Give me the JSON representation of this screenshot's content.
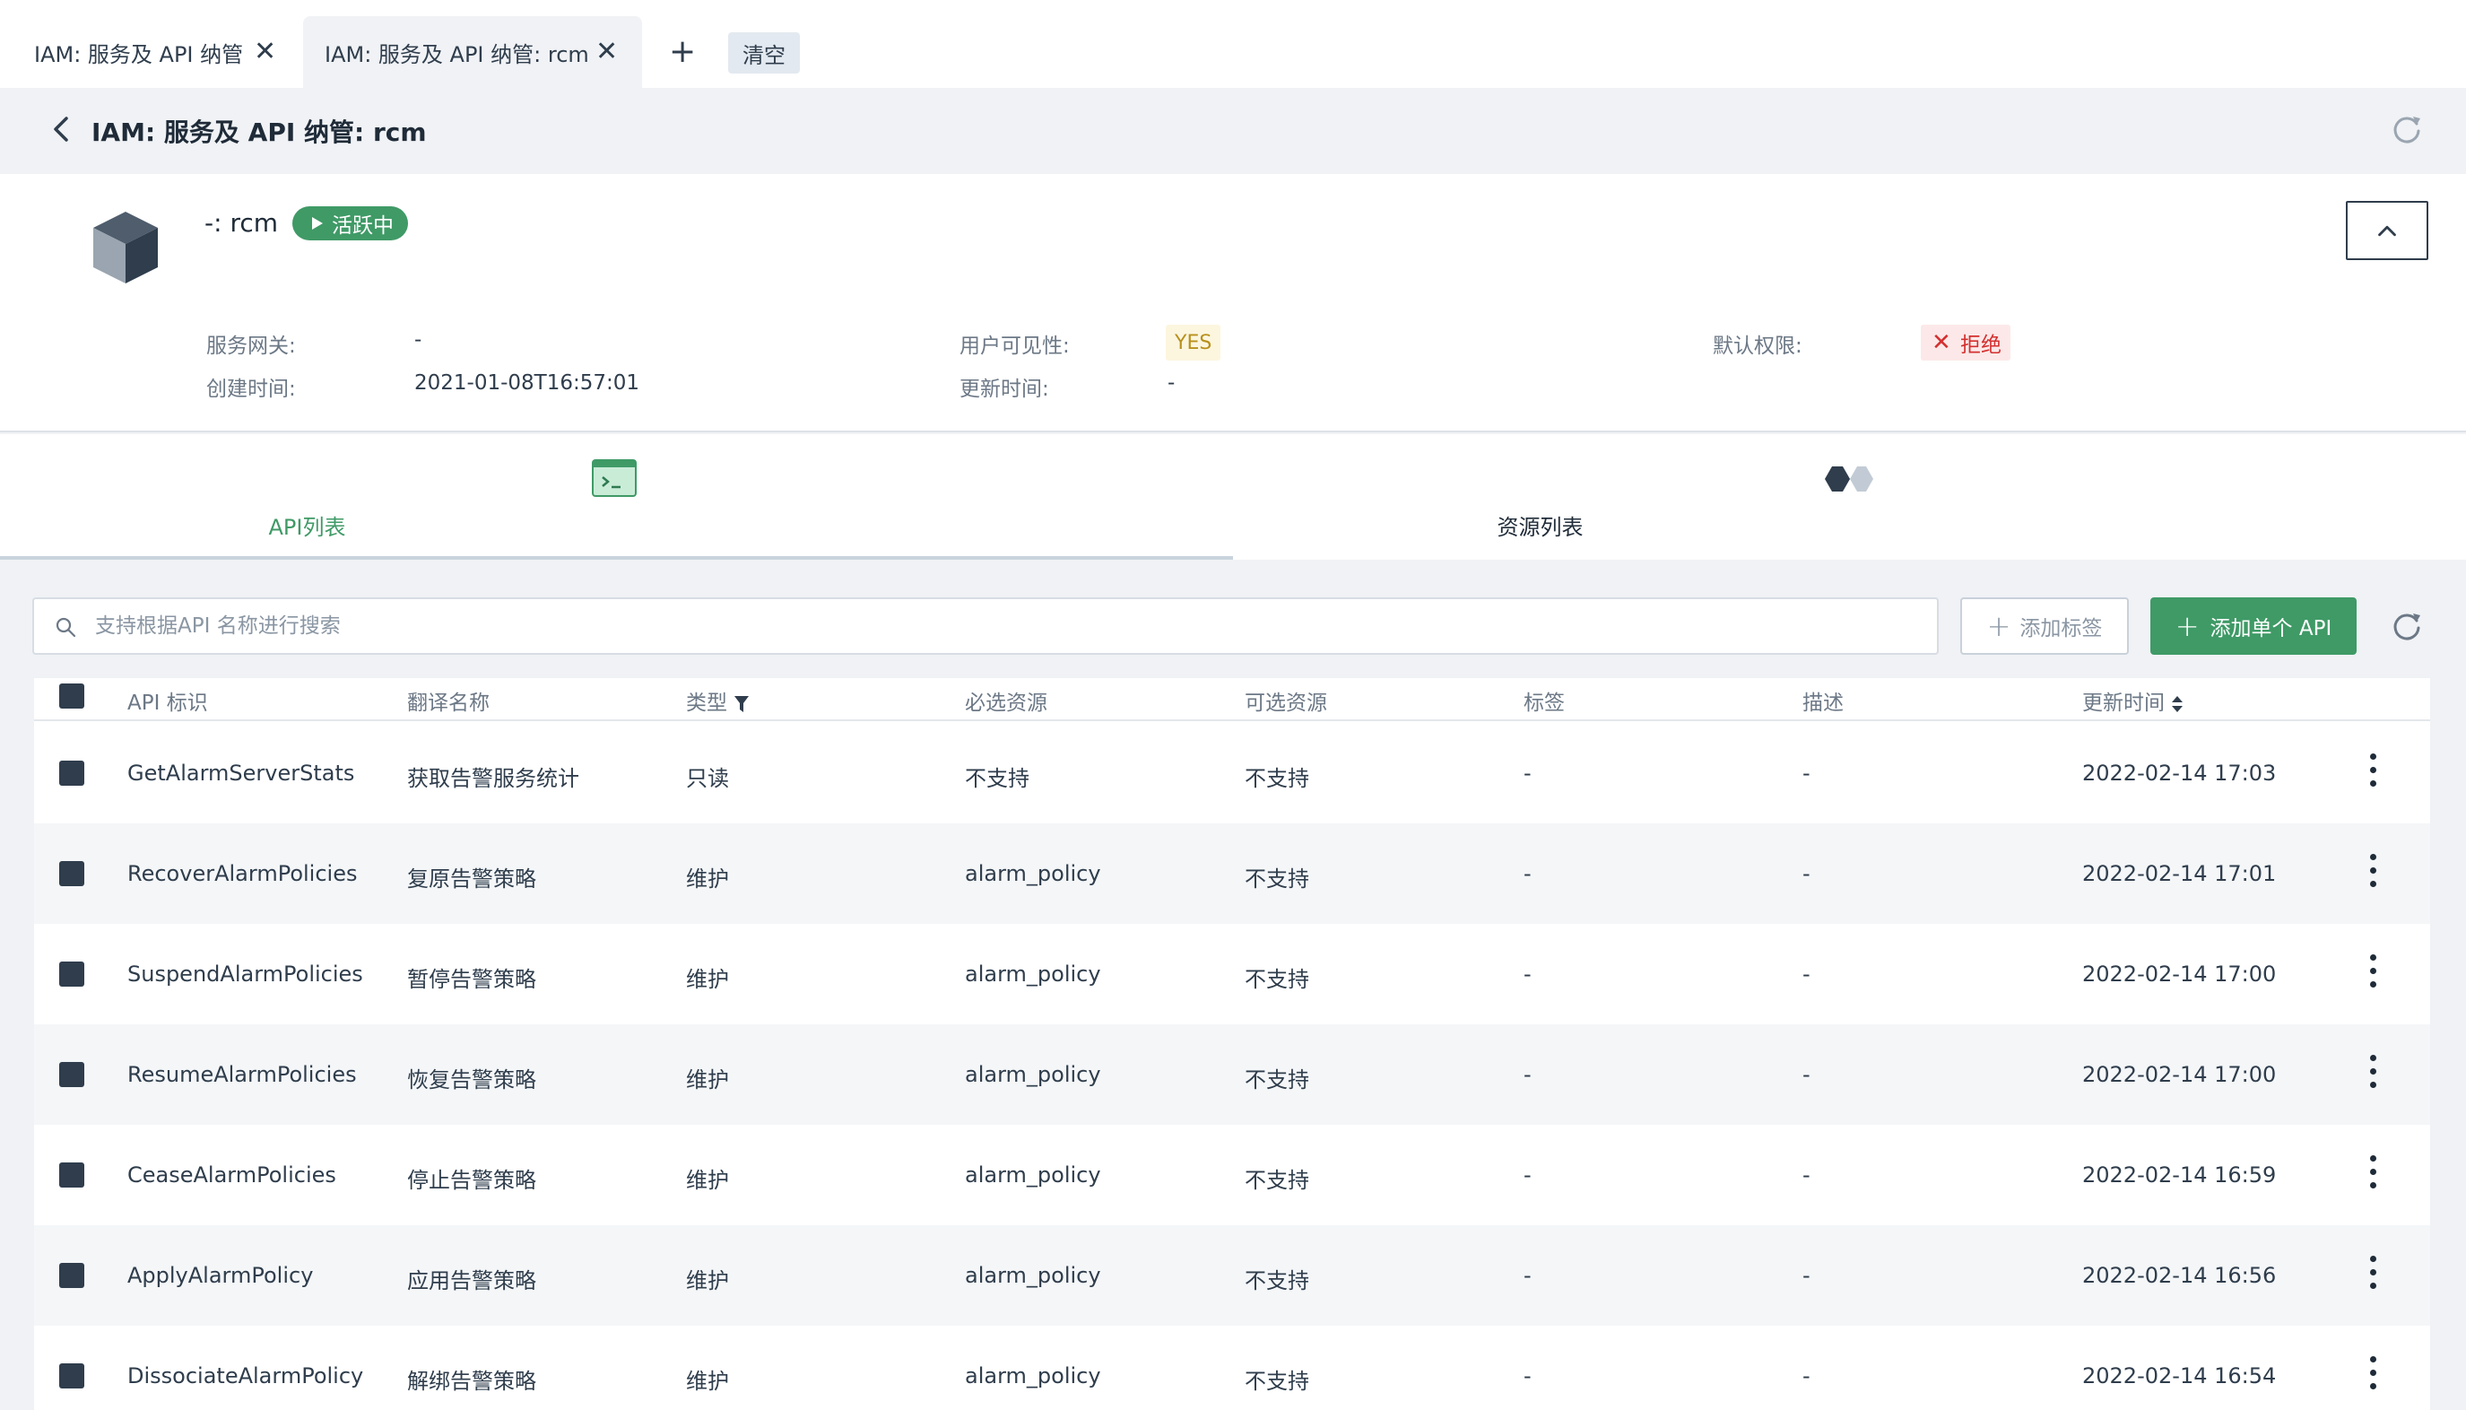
{
  "tabs": [
    {
      "label": "IAM: 服务及 API 纳管"
    },
    {
      "label": "IAM: 服务及 API 纳管: rcm"
    }
  ],
  "tab_clear_label": "清空",
  "header": {
    "title": "IAM: 服务及 API 纳管: rcm"
  },
  "service": {
    "name": "-: rcm",
    "status": "活跃中",
    "gateway_label": "服务网关:",
    "gateway_value": "-",
    "created_label": "创建时间:",
    "created_value": "2021-01-08T16:57:01",
    "visibility_label": "用户可见性:",
    "visibility_value": "YES",
    "updated_label": "更新时间:",
    "updated_value": "-",
    "default_perm_label": "默认权限:",
    "default_perm_value": "拒绝"
  },
  "subtabs": [
    {
      "label": "API列表"
    },
    {
      "label": "资源列表"
    }
  ],
  "search": {
    "placeholder": "支持根据API 名称进行搜索"
  },
  "toolbar": {
    "add_tag_label": "添加标签",
    "add_api_label": "添加单个 API"
  },
  "table": {
    "headers": [
      "API 标识",
      "翻译名称",
      "类型",
      "必选资源",
      "可选资源",
      "标签",
      "描述",
      "更新时间"
    ],
    "rows": [
      [
        "GetAlarmServerStats",
        "获取告警服务统计",
        "只读",
        "不支持",
        "不支持",
        "-",
        "-",
        "2022-02-14 17:03"
      ],
      [
        "RecoverAlarmPolicies",
        "复原告警策略",
        "维护",
        "alarm_policy",
        "不支持",
        "-",
        "-",
        "2022-02-14 17:01"
      ],
      [
        "SuspendAlarmPolicies",
        "暂停告警策略",
        "维护",
        "alarm_policy",
        "不支持",
        "-",
        "-",
        "2022-02-14 17:00"
      ],
      [
        "ResumeAlarmPolicies",
        "恢复告警策略",
        "维护",
        "alarm_policy",
        "不支持",
        "-",
        "-",
        "2022-02-14 17:00"
      ],
      [
        "CeaseAlarmPolicies",
        "停止告警策略",
        "维护",
        "alarm_policy",
        "不支持",
        "-",
        "-",
        "2022-02-14 16:59"
      ],
      [
        "ApplyAlarmPolicy",
        "应用告警策略",
        "维护",
        "alarm_policy",
        "不支持",
        "-",
        "-",
        "2022-02-14 16:56"
      ],
      [
        "DissociateAlarmPolicy",
        "解绑告警策略",
        "维护",
        "alarm_policy",
        "不支持",
        "-",
        "-",
        "2022-02-14 16:54"
      ]
    ]
  },
  "colors": {
    "accent": "#3f9a66",
    "dark": "#2f3d4c",
    "deny": "#d32f2f",
    "yes": "#b8901c"
  }
}
